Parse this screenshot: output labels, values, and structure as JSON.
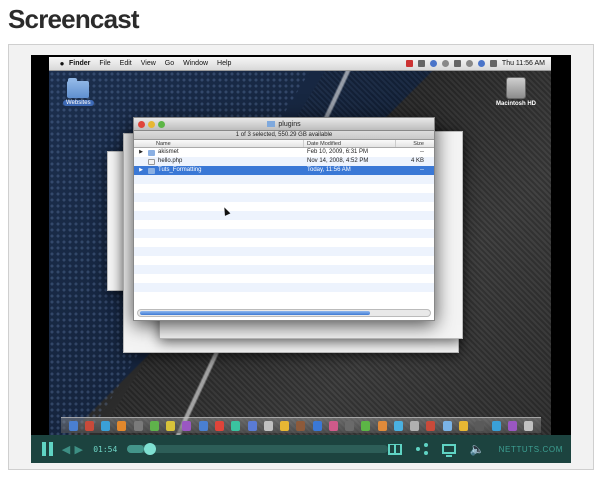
{
  "page": {
    "title": "Screencast"
  },
  "menubar": {
    "apple": "",
    "items": [
      "Finder",
      "File",
      "Edit",
      "View",
      "Go",
      "Window",
      "Help"
    ],
    "clock": "Thu 11:56 AM"
  },
  "desktop": {
    "folder_label": "Websites",
    "drive_label": "Macintosh HD"
  },
  "finder": {
    "title": "plugins",
    "status": "1 of 3 selected, 550.29 GB available",
    "columns": [
      "Name",
      "Date Modified",
      "Size"
    ],
    "rows": [
      {
        "name": "akismet",
        "date": "Feb 10, 2009, 6:31 PM",
        "size": "--",
        "selected": false
      },
      {
        "name": "hello.php",
        "date": "Nov 14, 2008, 4:52 PM",
        "size": "4 KB",
        "selected": false
      },
      {
        "name": "Tuts_Formatting",
        "date": "Today, 11:56 AM",
        "size": "--",
        "selected": true
      }
    ]
  },
  "controls": {
    "time": "01:54",
    "progress": 0.06,
    "brand": "NETTUTS.COM"
  }
}
